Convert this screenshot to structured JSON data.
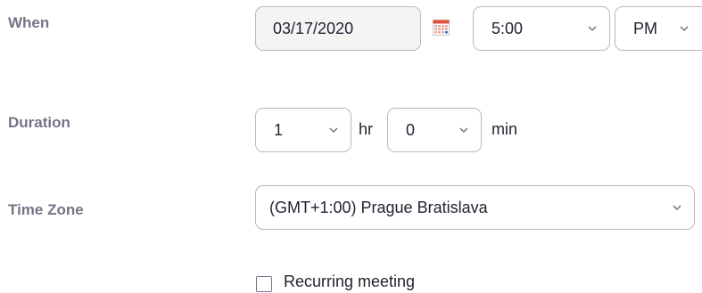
{
  "when": {
    "label": "When",
    "date": "03/17/2020",
    "time": "5:00",
    "ampm": "PM"
  },
  "duration": {
    "label": "Duration",
    "hours": "1",
    "hours_unit": "hr",
    "minutes": "0",
    "minutes_unit": "min"
  },
  "timezone": {
    "label": "Time Zone",
    "value": "(GMT+1:00) Prague Bratislava"
  },
  "recurring": {
    "label": "Recurring meeting",
    "checked": false
  },
  "icons": {
    "calendar": "calendar-icon",
    "dropdown": "chevron-down-icon"
  },
  "colors": {
    "label": "#747487",
    "text": "#232333",
    "border": "#bababa",
    "calendar_red": "#e0533d"
  }
}
